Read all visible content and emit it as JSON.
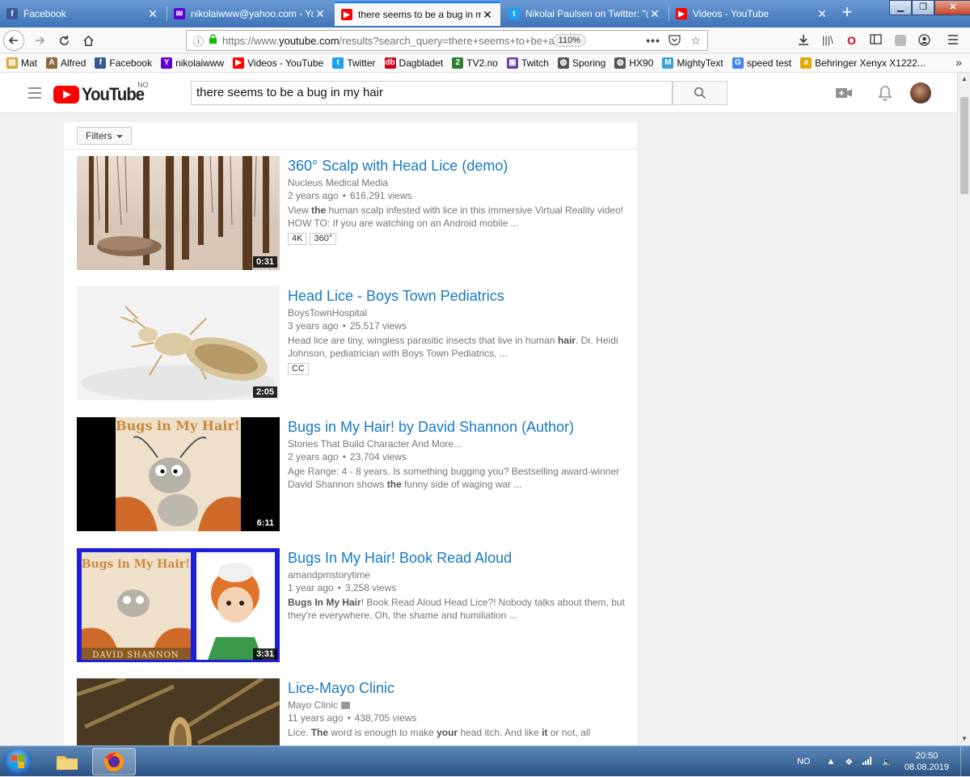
{
  "browser": {
    "tabs": [
      {
        "title": "Facebook",
        "icon": "facebook-icon",
        "color": "#3b5998"
      },
      {
        "title": "nikolaiwww@yahoo.com - Yahoo",
        "icon": "yahoo-mail-icon",
        "color": "#6001d2"
      },
      {
        "title": "there seems to be a bug in my hair",
        "icon": "youtube-icon",
        "color": "#ff0000"
      },
      {
        "title": "Nikolai Paulsen on Twitter: \"@",
        "icon": "twitter-icon",
        "color": "#1da1f2"
      },
      {
        "title": "Videos - YouTube",
        "icon": "youtube-icon",
        "color": "#ff0000"
      }
    ],
    "url_prefix": "https://www.",
    "url_domain": "youtube.com",
    "url_path": "/results?search_query=there+seems+to+be+a",
    "zoom": "110%"
  },
  "bookmarks": [
    {
      "label": "Mat",
      "icon": "folder-icon",
      "color": "#d9a43a"
    },
    {
      "label": "Alfred",
      "icon": "alfred-icon",
      "color": "#8b6a3e"
    },
    {
      "label": "Facebook",
      "icon": "facebook-icon",
      "color": "#3b5998"
    },
    {
      "label": "nikolaiwww",
      "icon": "yahoo-icon",
      "color": "#6001d2"
    },
    {
      "label": "Videos - YouTube",
      "icon": "youtube-icon",
      "color": "#ff0000"
    },
    {
      "label": "Twitter",
      "icon": "twitter-icon",
      "color": "#1da1f2"
    },
    {
      "label": "Dagbladet",
      "icon": "dagbladet-icon",
      "color": "#d0021b"
    },
    {
      "label": "TV2.no",
      "icon": "tv2-icon",
      "color": "#2e7d32"
    },
    {
      "label": "Twitch",
      "icon": "twitch-icon",
      "color": "#6441a5"
    },
    {
      "label": "Sporing",
      "icon": "globe-icon",
      "color": "#555555"
    },
    {
      "label": "HX90",
      "icon": "globe-icon",
      "color": "#555555"
    },
    {
      "label": "MightyText",
      "icon": "mightytext-icon",
      "color": "#3aa0d8"
    },
    {
      "label": "speed test",
      "icon": "google-icon",
      "color": "#4285f4"
    },
    {
      "label": "Behringer Xenyx X1222...",
      "icon": "amazon-icon",
      "color": "#e0a800"
    }
  ],
  "youtube": {
    "logo_text": "YouTube",
    "region": "NO",
    "search_query": "there seems to be a bug in my hair",
    "filters_label": "Filters"
  },
  "results": [
    {
      "title": "360° Scalp with Head Lice (demo)",
      "channel": "Nucleus Medical Media",
      "age": "2 years ago",
      "views": "616,291 views",
      "desc_html": "View <b>the</b> human scalp infested with lice in this immersive Virtual Reality video! HOW TO: If you are watching on an Android mobile ...",
      "badges": [
        "4K",
        "360°"
      ],
      "duration": "0:31",
      "verified": false
    },
    {
      "title": "Head Lice - Boys Town Pediatrics",
      "channel": "BoysTownHospital",
      "age": "3 years ago",
      "views": "25,517 views",
      "desc_html": "Head lice are tiny, wingless parasitic insects that live in human <b>hair</b>. Dr. Heidi Johnson, pediatrician with Boys Town Pediatrics, ...",
      "badges": [
        "CC"
      ],
      "duration": "2:05",
      "verified": false
    },
    {
      "title": "Bugs in My Hair! by David Shannon (Author)",
      "channel": "Stories That Build Character And More...",
      "age": "2 years ago",
      "views": "23,704 views",
      "desc_html": "Age Range: 4 - 8 years. Is something bugging you? Bestselling award-winner David Shannon shows <b>the</b> funny side of waging war ...",
      "badges": [],
      "duration": "6:11",
      "verified": false
    },
    {
      "title": "Bugs In My Hair! Book Read Aloud",
      "channel": "amandpmstorytime",
      "age": "1 year ago",
      "views": "3,258 views",
      "desc_html": "<b>Bugs In My Hair</b>! Book Read Aloud Head Lice?! Nobody talks about them, but they're everywhere. Oh, the shame and humiliation ...",
      "badges": [],
      "duration": "3:31",
      "verified": false
    },
    {
      "title": "Lice-Mayo Clinic",
      "channel": "Mayo Clinic",
      "age": "11 years ago",
      "views": "438,705 views",
      "desc_html": "Lice. <b>The</b> word is enough to make <b>your</b> head itch. And like <b>it</b> or not, all",
      "badges": [],
      "duration": "",
      "verified": true
    }
  ],
  "thumb_texts": {
    "book_title": "Bugs in My Hair!",
    "author": "DAVID SHANNON"
  },
  "taskbar": {
    "lang": "NO",
    "time": "20:50",
    "date": "08.08.2019"
  },
  "colors": {
    "youtube_red": "#ff0000",
    "link_blue": "#167ac6",
    "tab_accent": "#0a84ff"
  }
}
